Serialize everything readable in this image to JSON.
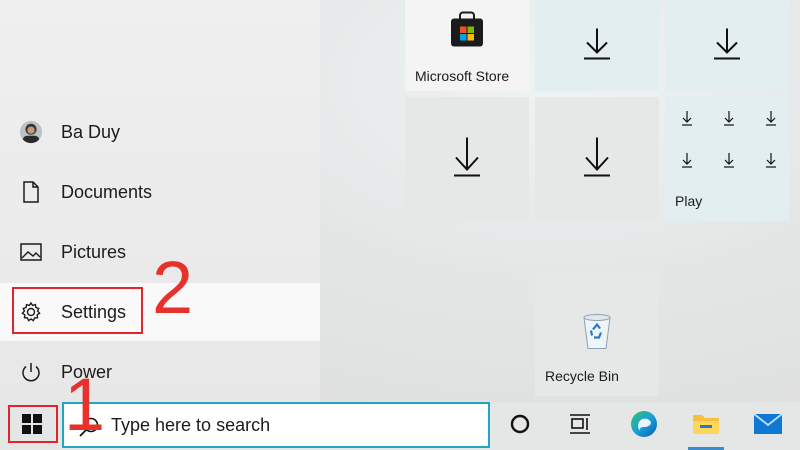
{
  "start_menu": {
    "items": [
      {
        "label": "Ba Duy",
        "icon": "user-avatar"
      },
      {
        "label": "Documents",
        "icon": "document-icon"
      },
      {
        "label": "Pictures",
        "icon": "pictures-icon"
      },
      {
        "label": "Settings",
        "icon": "gear-icon"
      },
      {
        "label": "Power",
        "icon": "power-icon"
      }
    ]
  },
  "tiles": {
    "store_label": "Microsoft Store",
    "play_label": "Play",
    "recycle_label": "Recycle Bin"
  },
  "annotations": {
    "step1": "1",
    "step2": "2",
    "highlight_color": "#e0252e"
  },
  "taskbar": {
    "search_placeholder": "Type here to search",
    "accent": "#1ea7bf"
  }
}
